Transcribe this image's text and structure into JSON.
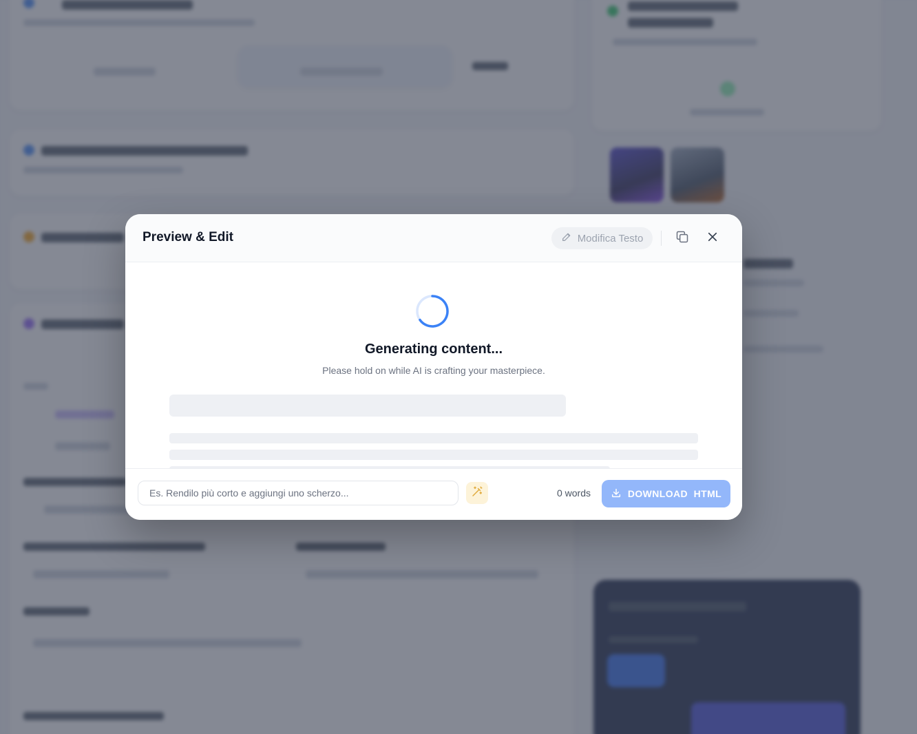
{
  "modal": {
    "title": "Preview & Edit",
    "edit_button_label": "Modifica Testo",
    "generating_title": "Generating content...",
    "generating_subtitle": "Please hold on while AI is crafting your masterpiece.",
    "prompt_placeholder": "Es. Rendilo più corto e aggiungi uno scherzo...",
    "word_count": "0 words",
    "download_label": "DOWNLOAD  HTML"
  },
  "icons": {
    "edit": "pencil-icon",
    "copy": "copy-icon",
    "close": "close-icon",
    "magic": "magic-wand-icon",
    "download": "download-icon",
    "loading": "spinner-icon"
  },
  "colors": {
    "accent": "#3b82f6",
    "download_button": "#93b7fa",
    "magic_button_bg": "#fdf3d9",
    "overlay": "#464c5c"
  }
}
